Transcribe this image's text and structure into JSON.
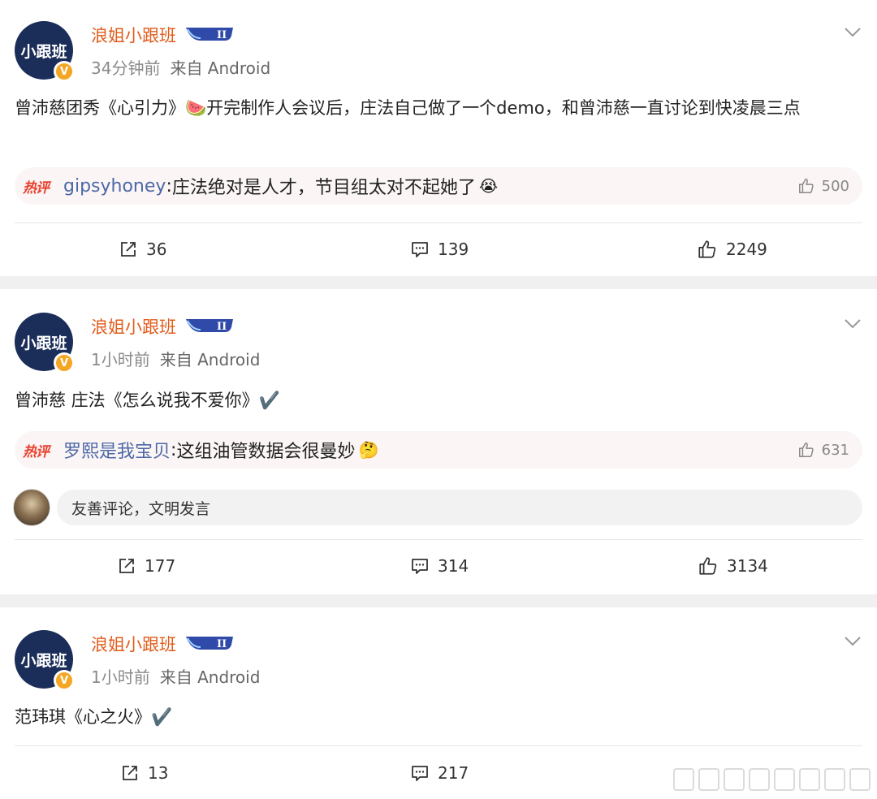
{
  "posts": [
    {
      "avatar_text": "小跟班",
      "verified": "V",
      "username": "浪姐小跟班",
      "time": "34分钟前",
      "source": "来自 Android",
      "content": "曾沛慈团秀《心引力》🍉开完制作人会议后，庄法自己做了一个demo，和曾沛慈一直讨论到快凌晨三点",
      "hot_tag": "热评",
      "hot_user": "gipsyhoney",
      "hot_text": "庄法绝对是人才，节目组太对不起她了",
      "hot_emoji": "😭",
      "hot_likes": "500",
      "reposts": "36",
      "comments": "139",
      "likes": "2249"
    },
    {
      "avatar_text": "小跟班",
      "verified": "V",
      "username": "浪姐小跟班",
      "time": "1小时前",
      "source": "来自 Android",
      "content": "曾沛慈 庄法《怎么说我不爱你》✔️",
      "hot_tag": "热评",
      "hot_user": "罗熙是我宝贝",
      "hot_text": "这组油管数据会很曼妙",
      "hot_emoji": "🤔",
      "hot_likes": "631",
      "reply_placeholder": "友善评论，文明发言",
      "reposts": "177",
      "comments": "314",
      "likes": "3134"
    },
    {
      "avatar_text": "小跟班",
      "verified": "V",
      "username": "浪姐小跟班",
      "time": "1小时前",
      "source": "来自 Android",
      "content": "范玮琪《心之火》✔️",
      "reposts": "13",
      "comments": "217"
    }
  ],
  "colors": {
    "username": "#e25c1b",
    "hot_tag": "#e8422f",
    "hot_user": "#4c68a7",
    "separator": "#f0f0f0"
  },
  "icons": [
    "chevron-down-icon",
    "repost-icon",
    "comment-icon",
    "thumbs-up-icon",
    "level-badge-icon",
    "verified-icon"
  ]
}
